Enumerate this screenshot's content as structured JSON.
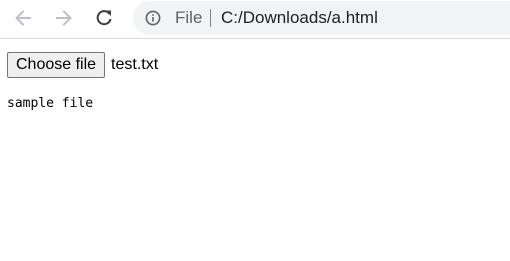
{
  "browser": {
    "nav": {
      "back_icon": "arrow-left-icon",
      "forward_icon": "arrow-right-icon",
      "reload_icon": "reload-icon"
    },
    "omnibox": {
      "info_icon": "info-icon",
      "scheme_label": "File",
      "url": "C:/Downloads/a.html"
    }
  },
  "page": {
    "file_input": {
      "button_label": "Choose file",
      "selected_file_name": "test.txt"
    },
    "file_content": "sample file"
  },
  "colors": {
    "omnibox_background": "#f1f3f4",
    "disabled_icon": "#bdc1c6",
    "active_icon": "#3c4043",
    "secondary_text": "#5f6368",
    "button_background": "#efefef"
  }
}
